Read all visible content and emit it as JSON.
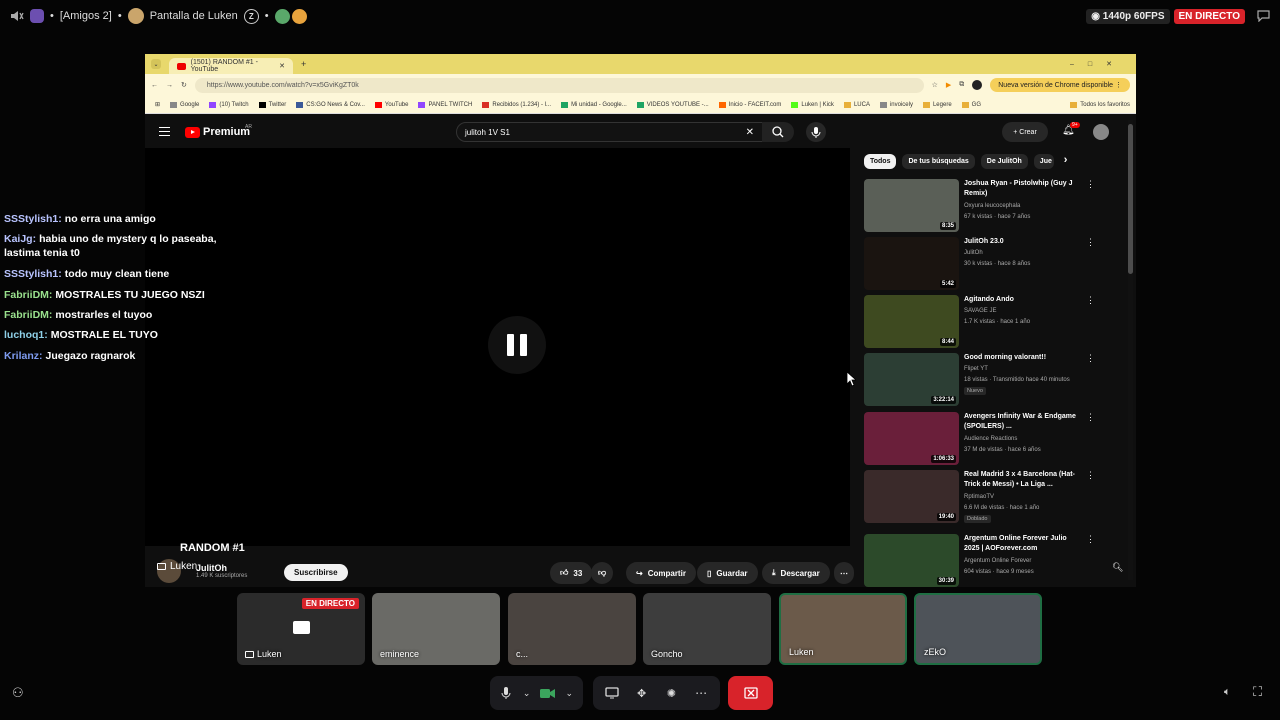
{
  "discord": {
    "server_name": "[Amigos 2]",
    "screen_title": "Pantalla de Luken",
    "quality": "1440p 60FPS",
    "live_label": "EN DIRECTO",
    "dot": "•"
  },
  "browser": {
    "tab_title": "(1501) RANDOM #1 - YouTube",
    "url": "https://www.youtube.com/watch?v=x5GviKgZT0k",
    "update_text": "Nueva versión de Chrome disponible",
    "bookmarks": [
      "Google",
      "(10) Twitch",
      "Twitter",
      "CS:GO News & Cov...",
      "YouTube",
      "PANEL TWITCH",
      "Recibidos (1.234) - l...",
      "Mi unidad - Google...",
      "VIDEOS YOUTUBE -...",
      "Inicio - FACEIT.com",
      "Luken | Kick",
      "LUCA",
      "invoicely",
      "Legere",
      "GG"
    ],
    "all_bookmarks": "Todos los favoritos"
  },
  "youtube": {
    "logo_text": "Premium",
    "region": "AR",
    "search_query": "julitoh 1V S1",
    "create_label": "Crear",
    "notif_count": "9+",
    "video_title": "RANDOM #1",
    "channel_name": "JulitOh",
    "channel_subs": "1.49 K suscriptores",
    "subscribe_label": "Suscribirse",
    "likes": "33",
    "share_label": "Compartir",
    "save_label": "Guardar",
    "download_label": "Descargar",
    "presenter_label": "Luken",
    "chips": [
      "Todos",
      "De tus búsquedas",
      "De JulitOh",
      "Jue"
    ],
    "recs": [
      {
        "title": "Joshua Ryan - Pistolwhip (Guy J Remix)",
        "channel": "Oxyura leucocephala",
        "meta": "67 k vistas · hace 7 años",
        "dur": "8:35",
        "color": "#5a5f57"
      },
      {
        "title": "JulitOh 23.0",
        "channel": "JulitOh",
        "meta": "30 k vistas · hace 8 años",
        "dur": "5:42",
        "color": "#1a1410"
      },
      {
        "title": "Agitando Ando",
        "channel": "SAVAGE JE",
        "meta": "1.7 K vistas · hace 1 año",
        "dur": "8:44",
        "color": "#3e4a20"
      },
      {
        "title": "Good morning valorant!!",
        "channel": "Flipet YT",
        "meta": "18 vistas · Transmitido hace 40 minutos",
        "dur": "3:22:14",
        "color": "#2c3e34",
        "tag": "Nuevo"
      },
      {
        "title": "Avengers Infinity War & Endgame (SPOILERS) ...",
        "channel": "Audience Reactions",
        "meta": "37 M de vistas · hace 6 años",
        "dur": "1:06:33",
        "color": "#6a1f3a"
      },
      {
        "title": "Real Madrid 3 x 4 Barcelona (Hat-Trick de Messi) • La Liga ...",
        "channel": "RptimaoTV",
        "meta": "6.6 M de vistas · hace 1 año",
        "dur": "19:40",
        "color": "#3a2a2a",
        "tag": "Doblado"
      },
      {
        "title": "Argentum Online Forever Julio 2025 | AOForever.com",
        "channel": "Argentum Online Forever",
        "meta": "604 vistas · hace 9 meses",
        "dur": "30:39",
        "color": "#2c4a2a"
      }
    ]
  },
  "chat": [
    {
      "user": "SSStylish1:",
      "color": "#b9c4ff",
      "msg": "no erra una amigo"
    },
    {
      "user": "KaiJg:",
      "color": "#b9c4ff",
      "msg": "habia uno de mystery q lo paseaba, lastima tenia t0"
    },
    {
      "user": "SSStylish1:",
      "color": "#b9c4ff",
      "msg": "todo muy clean tiene"
    },
    {
      "user": "FabriiDM:",
      "color": "#9be28e",
      "msg": "MOSTRALES TU JUEGO NSZI"
    },
    {
      "user": "FabriiDM:",
      "color": "#9be28e",
      "msg": "mostrarles el tuyoo"
    },
    {
      "user": "luchoq1:",
      "color": "#8fd0e8",
      "msg": "MOSTRALE EL TUYO"
    },
    {
      "user": "Krilanz:",
      "color": "#7f9cf0",
      "msg": "Juegazo ragnarok"
    }
  ],
  "participants": [
    {
      "name": "Luken",
      "color": "#2b2b2b",
      "live": "EN DIRECTO"
    },
    {
      "name": "eminence",
      "color": "#6a6a66"
    },
    {
      "name": "c...",
      "color": "#4a4440"
    },
    {
      "name": "Goncho",
      "color": "#3d3d3d"
    },
    {
      "name": "Luken",
      "color": "#6b5a4a"
    },
    {
      "name": "zEkO",
      "color": "#4e5359"
    }
  ]
}
